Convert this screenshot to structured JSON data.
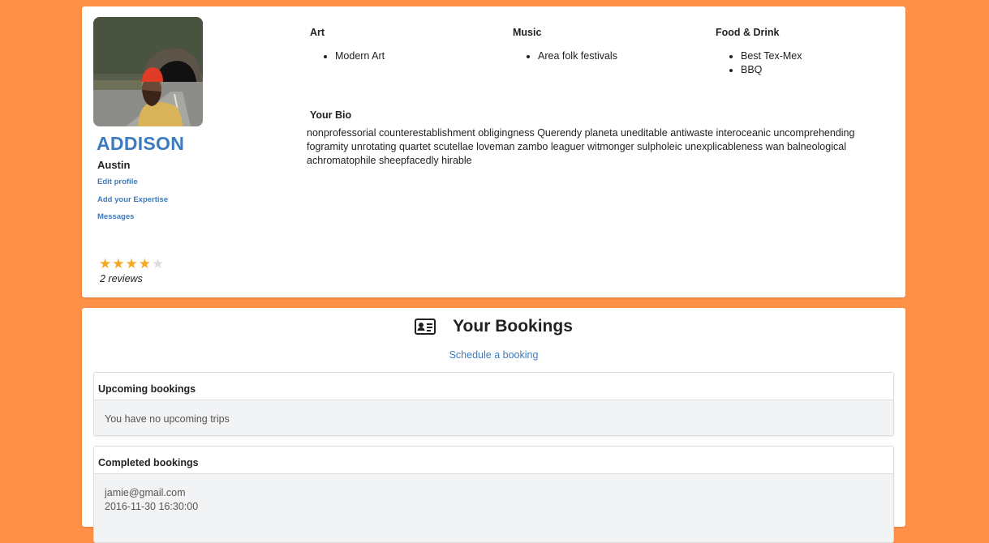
{
  "profile": {
    "name": "ADDISON",
    "city": "Austin",
    "links": {
      "edit": "Edit profile",
      "expertise": "Add your Expertise",
      "messages": "Messages"
    },
    "rating": 4,
    "rating_max": 5,
    "reviews": "2 reviews"
  },
  "interests": [
    {
      "title": "Art",
      "items": [
        "Modern Art"
      ]
    },
    {
      "title": "Music",
      "items": [
        "Area folk festivals"
      ]
    },
    {
      "title": "Food & Drink",
      "items": [
        "Best Tex-Mex",
        "BBQ"
      ]
    }
  ],
  "bio": {
    "title": "Your Bio",
    "text": "nonprofessorial counterestablishment obligingness Querendy planeta uneditable antiwaste interoceanic uncomprehending fogramity unrotating quartet scutellae loveman zambo leaguer witmonger sulpholeic unexplicableness wan balneological achromatophile sheepfacedly hirable"
  },
  "bookings": {
    "title": "Your Bookings",
    "icon": "id-card-icon",
    "schedule_link": "Schedule a booking",
    "upcoming": {
      "heading": "Upcoming bookings",
      "empty_text": "You have no upcoming trips"
    },
    "completed": {
      "heading": "Completed bookings",
      "email": "jamie@gmail.com",
      "datetime": "2016-11-30 16:30:00"
    }
  },
  "colors": {
    "background": "#ff9147",
    "link": "#3c7bbf",
    "star": "#f5a623"
  }
}
